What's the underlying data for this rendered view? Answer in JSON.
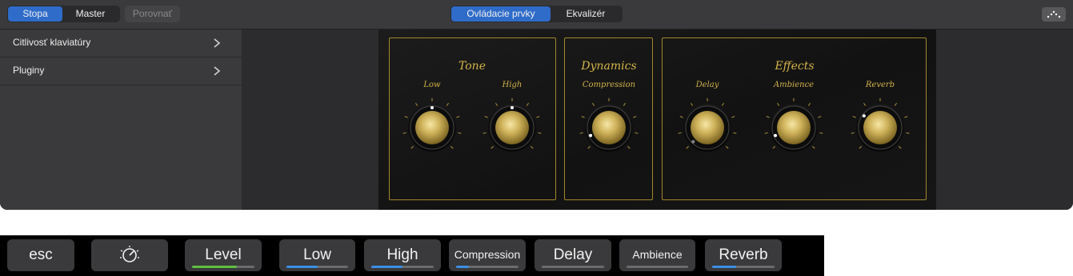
{
  "topbar": {
    "view_tabs": [
      {
        "label": "Stopa",
        "active": true
      },
      {
        "label": "Master",
        "active": false
      }
    ],
    "compare_label": "Porovnať",
    "mode_tabs": [
      {
        "label": "Ovládacie prvky",
        "active": true
      },
      {
        "label": "Ekvalizér",
        "active": false
      }
    ],
    "corner_icon": "dots-menu-icon"
  },
  "sidebar": {
    "items": [
      {
        "label": "Citlivosť klaviatúry",
        "icon": "chevron-right-icon"
      },
      {
        "label": "Pluginy",
        "icon": "chevron-right-icon"
      }
    ]
  },
  "plugin": {
    "accent_color": "#d4b44a",
    "sections": [
      {
        "title": "Tone",
        "knobs": [
          {
            "label": "Low",
            "value": 0.5
          },
          {
            "label": "High",
            "value": 0.5
          }
        ]
      },
      {
        "title": "Dynamics",
        "knobs": [
          {
            "label": "Compression",
            "value": 0.08
          }
        ]
      },
      {
        "title": "Effects",
        "knobs": [
          {
            "label": "Delay",
            "value": 0.0
          },
          {
            "label": "Ambience",
            "value": 0.08
          },
          {
            "label": "Reverb",
            "value": 0.3
          }
        ]
      }
    ]
  },
  "touchbar": {
    "esc_label": "esc",
    "smart_controls_icon": "smart-controls-knob-icon",
    "buttons": [
      {
        "label": "Level",
        "value": 0.72,
        "color": "#5fbf3f"
      },
      {
        "label": "Low",
        "value": 0.5,
        "color": "#3a8ee6"
      },
      {
        "label": "High",
        "value": 0.5,
        "color": "#3a8ee6"
      },
      {
        "label": "Compression",
        "value": 0.2,
        "color": "#3a8ee6"
      },
      {
        "label": "Delay",
        "value": 0.0,
        "color": "#3a8ee6"
      },
      {
        "label": "Ambience",
        "value": 0.0,
        "color": "#3a8ee6"
      },
      {
        "label": "Reverb",
        "value": 0.38,
        "color": "#3a8ee6"
      }
    ]
  }
}
